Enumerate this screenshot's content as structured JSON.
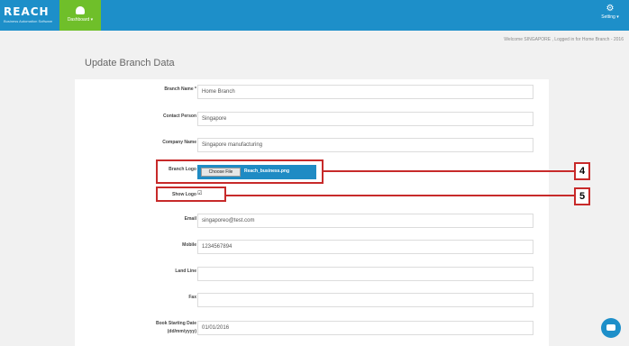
{
  "brand": {
    "name": "REACH",
    "tagline": "Business Automation Software"
  },
  "nav": {
    "dashboard_label": "Dashboard ▾",
    "settings_label": "Setting ▾"
  },
  "welcome_text": "Welcome SINGAPORE , Logged in for Home Branch - 2016",
  "page_title": "Update Branch Data",
  "form": {
    "branch_name": {
      "label": "Branch Name *",
      "value": "Home Branch"
    },
    "contact_person": {
      "label": "Contact Person",
      "value": "Singapore"
    },
    "company_name": {
      "label": "Company Name",
      "value": "Singapore manufacturing"
    },
    "branch_logo": {
      "label": "Branch Logo",
      "button": "Choose File",
      "file": "Reach_business.png"
    },
    "show_logo": {
      "label": "Show Logo",
      "checked": true
    },
    "email": {
      "label": "Email",
      "value": "singaporeo@test.com"
    },
    "mobile": {
      "label": "Mobile",
      "value": "1234567894"
    },
    "land_line": {
      "label": "Land Line",
      "value": ""
    },
    "fax": {
      "label": "Fax",
      "value": ""
    },
    "book_starting_date": {
      "label": "Book Starting Date",
      "label2": "(dd/mm/yyyy)",
      "value": "01/01/2016"
    }
  },
  "callouts": {
    "logo_tag": "4",
    "show_logo_tag": "5"
  },
  "colors": {
    "topbar": "#1d8fc9",
    "dashboard": "#6fbf2a",
    "highlight": "#c72a2a"
  }
}
